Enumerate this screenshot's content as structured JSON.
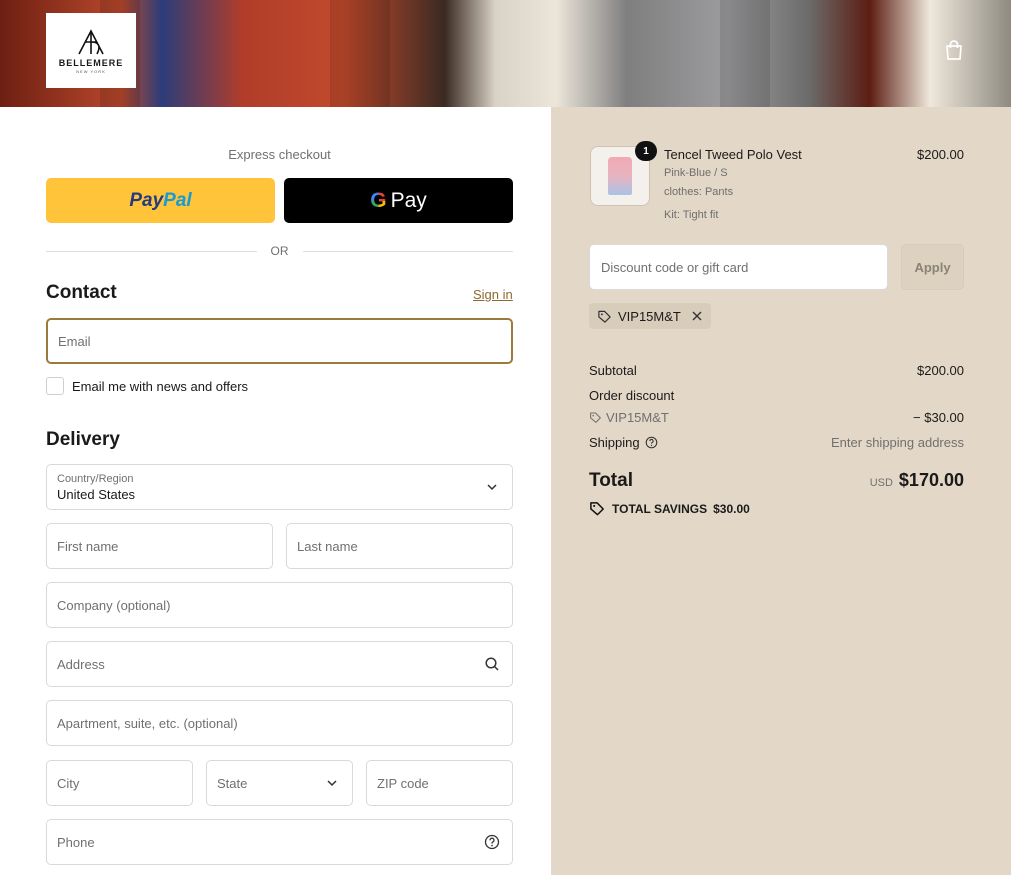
{
  "header": {
    "brand": "BELLEMERE",
    "brand_sub": "NEW YORK"
  },
  "express": {
    "label": "Express checkout",
    "paypal_1": "Pay",
    "paypal_2": "Pal",
    "gpay_g": "G",
    "gpay_label": "Pay",
    "or": "OR"
  },
  "contact": {
    "title": "Contact",
    "sign_in": "Sign in",
    "email_placeholder": "Email",
    "newsletter_label": "Email me with news and offers"
  },
  "delivery": {
    "title": "Delivery",
    "country_label": "Country/Region",
    "country_value": "United States",
    "first_name": "First name",
    "last_name": "Last name",
    "company": "Company (optional)",
    "address": "Address",
    "apartment": "Apartment, suite, etc. (optional)",
    "city": "City",
    "state": "State",
    "zip": "ZIP code",
    "phone": "Phone"
  },
  "order": {
    "item": {
      "quantity": "1",
      "name": "Tencel Tweed Polo Vest",
      "variant": "Pink-Blue / S",
      "option1": "clothes: Pants",
      "option2": "Kit: Tight fit",
      "price": "$200.00"
    },
    "discount_placeholder": "Discount code or gift card",
    "apply": "Apply",
    "applied_code": "VIP15M&T",
    "subtotal_label": "Subtotal",
    "subtotal_value": "$200.00",
    "order_discount_label": "Order discount",
    "discount_code": "VIP15M&T",
    "discount_value": "− $30.00",
    "shipping_label": "Shipping",
    "shipping_value": "Enter shipping address",
    "total_label": "Total",
    "currency": "USD",
    "total_value": "$170.00",
    "savings_label": "TOTAL SAVINGS",
    "savings_value": "$30.00"
  },
  "colors": {
    "accent": "#9b7a3b",
    "summary_bg": "#e3d8c7",
    "paypal": "#ffc439"
  }
}
